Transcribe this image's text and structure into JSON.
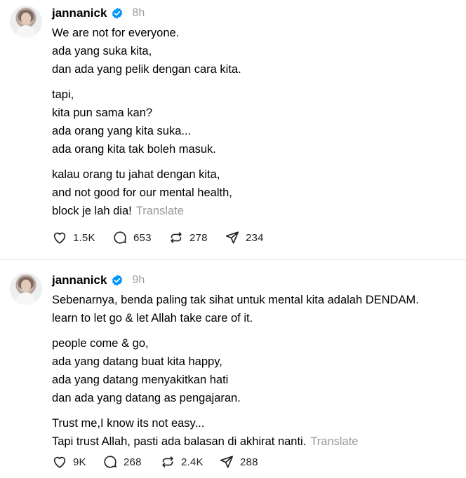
{
  "posts": [
    {
      "username": "jannanick",
      "time": "8h",
      "paragraphs": [
        [
          "We are not for everyone.",
          "ada yang suka kita,",
          "dan ada yang pelik dengan cara kita."
        ],
        [
          "tapi,",
          "kita pun sama kan?",
          "ada orang yang kita suka...",
          "ada orang kita tak boleh masuk."
        ],
        [
          "kalau orang tu jahat dengan kita,",
          "and not good for our mental health,",
          "block je lah dia!"
        ]
      ],
      "translate_label": "Translate",
      "likes": "1.5K",
      "replies": "653",
      "reposts": "278",
      "shares": "234"
    },
    {
      "username": "jannanick",
      "time": "9h",
      "paragraphs": [
        [
          "Sebenarnya, benda paling tak sihat untuk mental kita adalah DENDAM.",
          "learn to let go & let Allah take care of it."
        ],
        [
          "people come & go,",
          "ada yang datang buat kita happy,",
          "ada yang datang menyakitkan hati",
          "dan ada yang datang as pengajaran."
        ],
        [
          "Trust me,I know its not easy...",
          "Tapi trust Allah, pasti ada balasan di akhirat nanti."
        ]
      ],
      "translate_label": "Translate",
      "likes": "9K",
      "replies": "268",
      "reposts": "2.4K",
      "shares": "288"
    }
  ],
  "icons": {
    "like": "heart-icon",
    "reply": "speech-bubble-icon",
    "repost": "repost-arrows-icon",
    "share": "send-paper-plane-icon",
    "verified": "verified-badge-icon"
  },
  "colors": {
    "verified": "#0095f6",
    "muted": "#999999",
    "divider": "#e4e4e4"
  }
}
